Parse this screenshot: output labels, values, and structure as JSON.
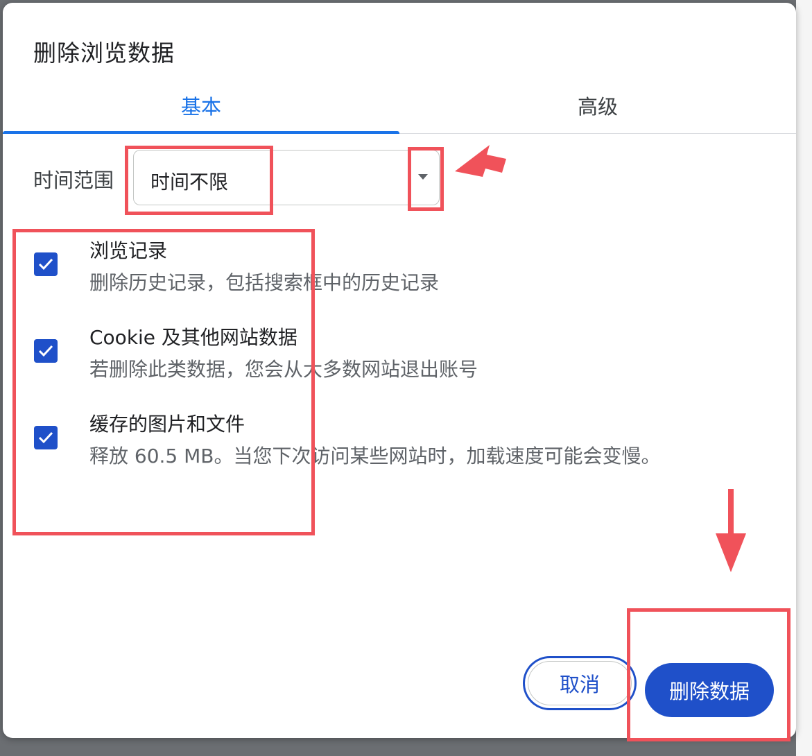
{
  "dialog": {
    "title": "删除浏览数据",
    "tabs": [
      {
        "label": "基本",
        "active": true
      },
      {
        "label": "高级",
        "active": false
      }
    ],
    "time_range": {
      "label": "时间范围",
      "value": "时间不限"
    },
    "options": [
      {
        "title": "浏览记录",
        "description": "删除历史记录，包括搜索框中的历史记录",
        "checked": true
      },
      {
        "title": "Cookie 及其他网站数据",
        "description": "若删除此类数据，您会从大多数网站退出账号",
        "checked": true
      },
      {
        "title": "缓存的图片和文件",
        "description": "释放 60.5 MB。当您下次访问某些网站时，加载速度可能会变慢。",
        "checked": true
      }
    ],
    "buttons": {
      "cancel_label": "取消",
      "delete_label": "删除数据"
    }
  },
  "colors": {
    "accent": "#1a73e8",
    "primary_button": "#1f50c9",
    "annotation": "#f0525a"
  },
  "icons": {
    "dropdown": "triangle-down-icon",
    "checkbox": "checkmark-icon",
    "annotation_arrow": "red-arrow-icon"
  }
}
